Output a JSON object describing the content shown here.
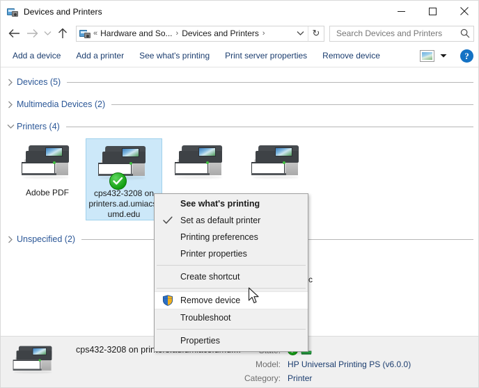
{
  "window": {
    "title": "Devices and Printers",
    "icon": "devices-and-printers-icon",
    "minimize_label": "–",
    "maximize_label": "□",
    "close_label": "✕"
  },
  "navigation": {
    "back_icon": "arrow-left-icon",
    "forward_icon": "arrow-right-icon",
    "recent_icon": "chevron-down-icon",
    "up_icon": "arrow-up-icon"
  },
  "address_bar": {
    "icon": "devices-and-printers-icon",
    "overflow": "«",
    "crumbs": [
      "Hardware and So...",
      "Devices and Printers"
    ],
    "separator": "›",
    "dropdown_icon": "chevron-down-icon",
    "refresh_icon": "refresh-icon",
    "refresh_glyph": "↻"
  },
  "search": {
    "placeholder": "Search Devices and Printers",
    "value": "",
    "icon": "search-icon"
  },
  "toolbar": {
    "buttons": [
      "Add a device",
      "Add a printer",
      "See what's printing",
      "Print server properties",
      "Remove device"
    ],
    "view_icon": "view-thumbnail-icon",
    "view_caret_icon": "chevron-down-icon",
    "help_label": "?",
    "help_icon": "help-icon"
  },
  "groups": [
    {
      "label": "Devices (5)",
      "expanded": false,
      "chevron": "chevron-right-icon"
    },
    {
      "label": "Multimedia Devices (2)",
      "expanded": false,
      "chevron": "chevron-right-icon"
    },
    {
      "label": "Printers (4)",
      "expanded": true,
      "chevron": "chevron-down-icon"
    },
    {
      "label": "Unspecified (2)",
      "expanded": false,
      "chevron": "chevron-right-icon"
    }
  ],
  "printers": [
    {
      "label": "Adobe PDF",
      "selected": false,
      "is_default": false
    },
    {
      "label": "cps432-3208 on printers.ad.umiacs.umd.edu",
      "selected": true,
      "is_default": true
    },
    {
      "label": "",
      "selected": false,
      "is_default": false
    },
    {
      "label": "",
      "selected": false,
      "is_default": false
    }
  ],
  "obscured_label_fragment": "c",
  "context_menu": {
    "items": [
      {
        "label": "See what's printing",
        "bold": true,
        "checked": false,
        "shield": false,
        "hovered": false,
        "separator_after": false
      },
      {
        "label": "Set as default printer",
        "bold": false,
        "checked": true,
        "shield": false,
        "hovered": false,
        "separator_after": false
      },
      {
        "label": "Printing preferences",
        "bold": false,
        "checked": false,
        "shield": false,
        "hovered": false,
        "separator_after": false
      },
      {
        "label": "Printer properties",
        "bold": false,
        "checked": false,
        "shield": false,
        "hovered": false,
        "separator_after": true
      },
      {
        "label": "Create shortcut",
        "bold": false,
        "checked": false,
        "shield": false,
        "hovered": false,
        "separator_after": true
      },
      {
        "label": "Remove device",
        "bold": false,
        "checked": false,
        "shield": true,
        "hovered": true,
        "separator_after": false
      },
      {
        "label": "Troubleshoot",
        "bold": false,
        "checked": false,
        "shield": false,
        "hovered": false,
        "separator_after": true
      },
      {
        "label": "Properties",
        "bold": false,
        "checked": false,
        "shield": false,
        "hovered": false,
        "separator_after": false
      }
    ]
  },
  "details": {
    "icon": "printer-icon",
    "name": "cps432-3208 on printers.ad.umiacs.umd....",
    "fields": [
      {
        "label": "State:",
        "value": "",
        "icons": [
          "default-printer-check-icon",
          "shared-printer-icon"
        ]
      },
      {
        "label": "Model:",
        "value": "HP Universal Printing PS (v6.0.0)",
        "icons": []
      },
      {
        "label": "Category:",
        "value": "Printer",
        "icons": []
      }
    ]
  },
  "colors": {
    "accent_blue": "#1a3c6e",
    "group_header_blue": "#2b5797",
    "selection_fill": "#cce8f9",
    "selection_border": "#9fd1ec",
    "menu_bg": "#f0f0f0",
    "details_bg": "#f0f0f0",
    "status_green": "#13a013",
    "help_blue": "#1472c4"
  }
}
